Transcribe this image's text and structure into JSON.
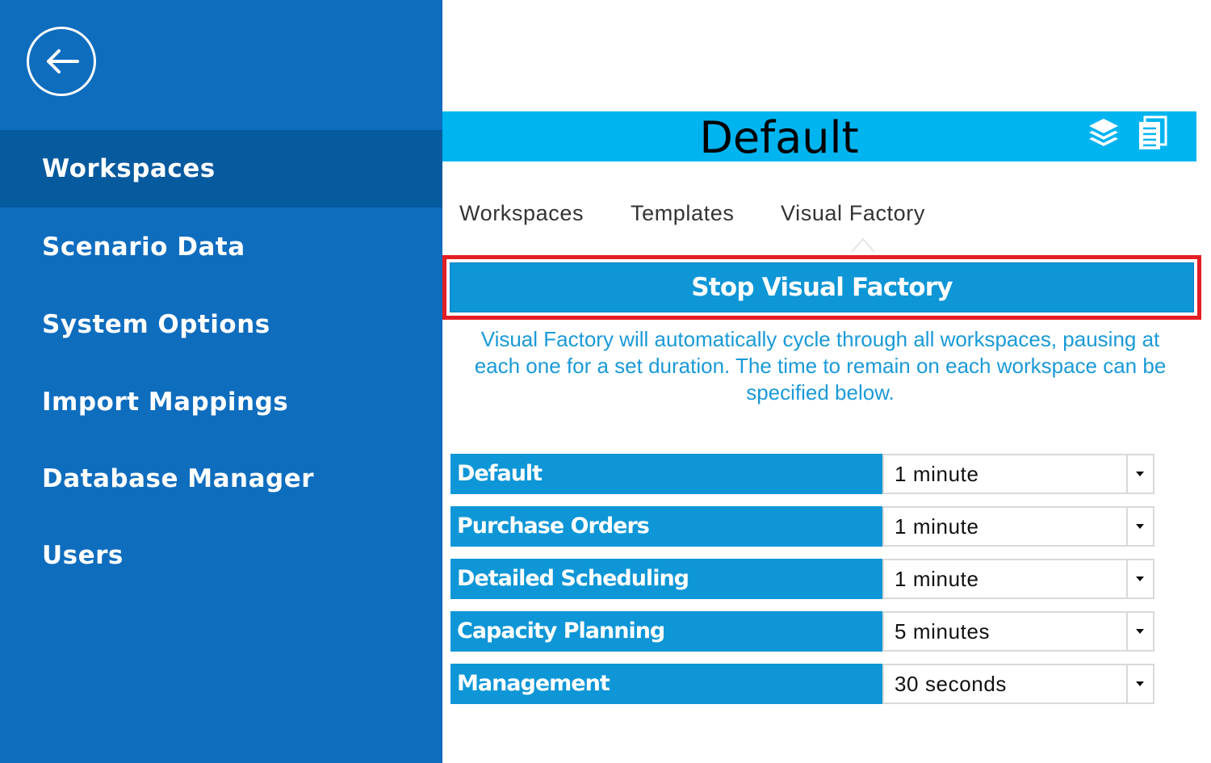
{
  "sidebar": {
    "back_icon": "arrow-left-circle-icon",
    "items": [
      {
        "label": "Workspaces",
        "active": true
      },
      {
        "label": "Scenario Data",
        "active": false
      },
      {
        "label": "System Options",
        "active": false
      },
      {
        "label": "Import Mappings",
        "active": false
      },
      {
        "label": "Database Manager",
        "active": false
      },
      {
        "label": "Users",
        "active": false
      }
    ]
  },
  "header": {
    "title": "Default",
    "icons": [
      "layers-icon",
      "document-list-icon"
    ]
  },
  "tabs": [
    {
      "label": "Workspaces"
    },
    {
      "label": "Templates"
    },
    {
      "label": "Visual Factory",
      "selected": true
    }
  ],
  "visual_factory": {
    "stop_button_label": "Stop Visual Factory",
    "description": "Visual Factory will automatically cycle through all workspaces, pausing at each one for a set duration. The time to remain on each workspace can be specified below.",
    "workspaces": [
      {
        "name": "Default",
        "duration": "1 minute"
      },
      {
        "name": "Purchase Orders",
        "duration": "1 minute"
      },
      {
        "name": "Detailed Scheduling",
        "duration": "1 minute"
      },
      {
        "name": "Capacity Planning",
        "duration": "5 minutes"
      },
      {
        "name": "Management",
        "duration": "30 seconds"
      }
    ]
  },
  "colors": {
    "sidebar_bg": "#0f6dbe",
    "sidebar_active": "#065a9e",
    "title_bar": "#00b4f0",
    "accent": "#0e96d6",
    "highlight": "#e31e24",
    "description_text": "#1a9ad8"
  }
}
